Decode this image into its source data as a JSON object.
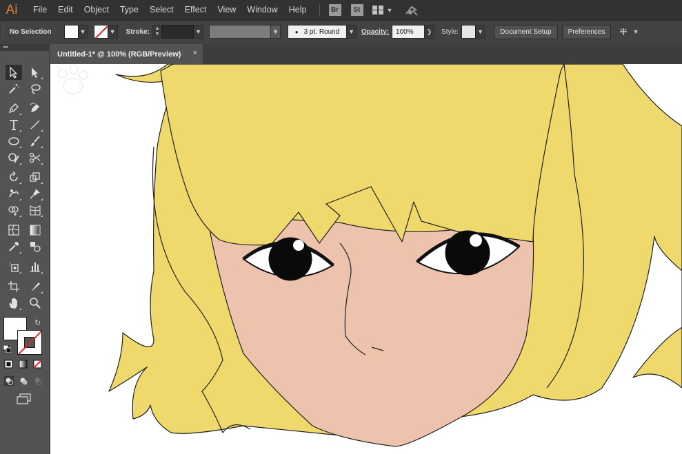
{
  "app": {
    "logo": "Ai"
  },
  "menu": [
    "File",
    "Edit",
    "Object",
    "Type",
    "Select",
    "Effect",
    "View",
    "Window",
    "Help"
  ],
  "app_badges": {
    "bridge": "Br",
    "stock": "St"
  },
  "control_bar": {
    "selection_label": "No Selection",
    "stroke_label": "Stroke:",
    "brush_profile": "3 pt. Round",
    "opacity_label": "Opacity:",
    "opacity_value": "100%",
    "style_label": "Style:",
    "document_setup_label": "Document Setup",
    "preferences_label": "Preferences"
  },
  "document": {
    "tab_title": "Untitled-1* @ 100% (RGB/Preview)",
    "close_glyph": "×"
  },
  "colors": {
    "hair": "#f0d96c",
    "skin": "#eec3ae",
    "outline": "#1e1e1e",
    "app_accent": "#e8812c"
  },
  "icons": {
    "swap": "swap-fill-stroke-icon",
    "default": "default-colors-icon"
  }
}
